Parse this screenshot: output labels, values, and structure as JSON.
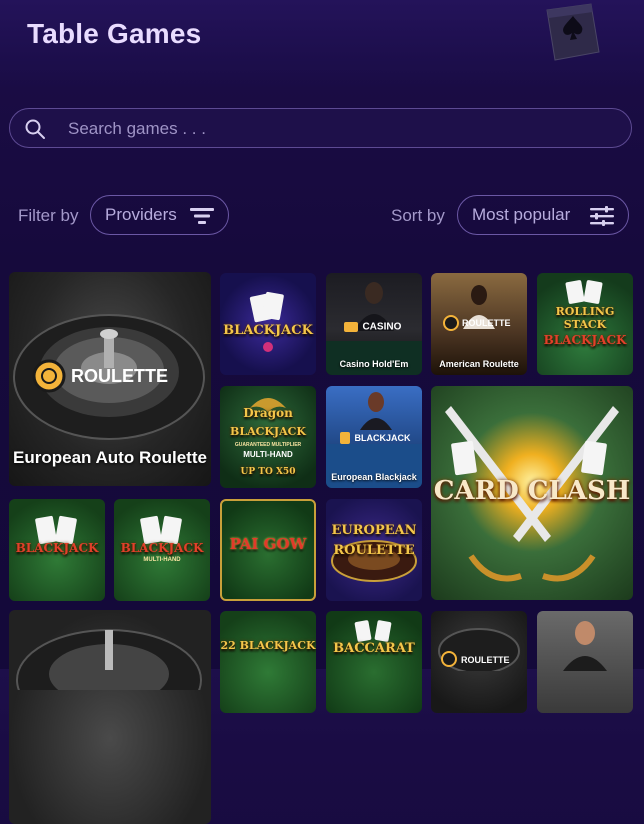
{
  "header": {
    "title": "Table Games",
    "decor_icon": "spade-card-icon"
  },
  "search": {
    "placeholder": "Search games . . ."
  },
  "filters": {
    "filter_label": "Filter by",
    "providers_label": "Providers",
    "sort_label": "Sort by",
    "sort_value": "Most popular"
  },
  "games": {
    "european_auto_roulette": {
      "badge": "ROULETTE",
      "name": "European Auto Roulette"
    },
    "blackjack_1": {
      "art": "BLACKJACK"
    },
    "casino_holdem": {
      "badge": "CASINO",
      "name": "Casino Hold'Em"
    },
    "american_roulette": {
      "badge": "ROULETTE",
      "name": "American Roulette"
    },
    "rolling_stack": {
      "art_top": "ROLLING STACK",
      "art_bottom": "BLACKJACK"
    },
    "dragon_blackjack": {
      "art_top": "Dragon",
      "art_mid": "BLACKJACK",
      "art_small": "GUARANTEED MULTIPLIER",
      "art_bottom": "MULTI-HAND",
      "art_note": "UP TO X50"
    },
    "european_blackjack": {
      "badge": "BLACKJACK",
      "name": "European Blackjack"
    },
    "card_clash": {
      "art": "CARD CLASH"
    },
    "blackjack_2": {
      "art": "BLACKJACK"
    },
    "blackjack_multihand": {
      "art": "BLACKJACK",
      "art_small": "MULTI-HAND"
    },
    "pai_gow": {
      "art": "PAI GOW"
    },
    "european_roulette": {
      "art_top": "EUROPEAN",
      "art_bottom": "ROULETTE"
    },
    "blackjack_22": {
      "art": "22 BLACKJACK"
    },
    "baccarat": {
      "art": "BACCARAT"
    },
    "roulette_bottom": {
      "badge": "ROULETTE"
    }
  },
  "colors": {
    "accent": "#e9dcff",
    "background": "#160a3c",
    "border": "#5d4a93",
    "gold": "#f3c64a"
  }
}
